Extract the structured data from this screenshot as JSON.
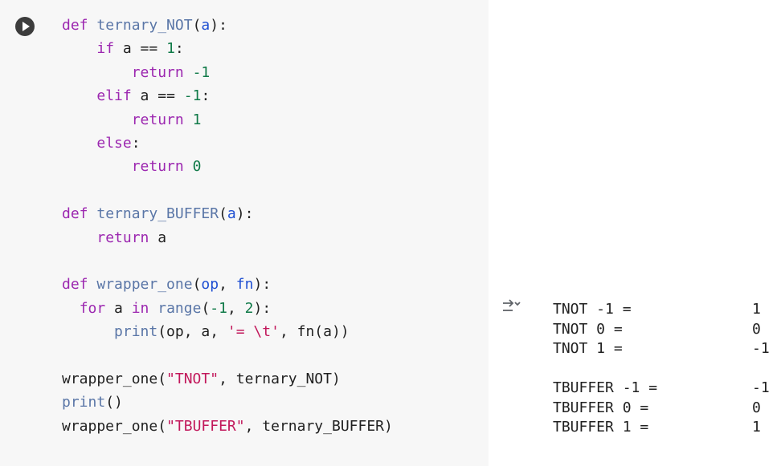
{
  "cell": {
    "code_tokens": [
      [
        [
          "kw",
          "def"
        ],
        [
          "plain",
          " "
        ],
        [
          "fn",
          "ternary_NOT"
        ],
        [
          "plain",
          "("
        ],
        [
          "param",
          "a"
        ],
        [
          "plain",
          "):"
        ]
      ],
      [
        [
          "plain",
          "    "
        ],
        [
          "kw",
          "if"
        ],
        [
          "plain",
          " a == "
        ],
        [
          "num",
          "1"
        ],
        [
          "plain",
          ":"
        ]
      ],
      [
        [
          "plain",
          "        "
        ],
        [
          "kw",
          "return"
        ],
        [
          "plain",
          " "
        ],
        [
          "num",
          "-1"
        ]
      ],
      [
        [
          "plain",
          "    "
        ],
        [
          "kw",
          "elif"
        ],
        [
          "plain",
          " a == "
        ],
        [
          "num",
          "-1"
        ],
        [
          "plain",
          ":"
        ]
      ],
      [
        [
          "plain",
          "        "
        ],
        [
          "kw",
          "return"
        ],
        [
          "plain",
          " "
        ],
        [
          "num",
          "1"
        ]
      ],
      [
        [
          "plain",
          "    "
        ],
        [
          "kw",
          "else"
        ],
        [
          "plain",
          ":"
        ]
      ],
      [
        [
          "plain",
          "        "
        ],
        [
          "kw",
          "return"
        ],
        [
          "plain",
          " "
        ],
        [
          "num",
          "0"
        ]
      ],
      [
        [
          "plain",
          ""
        ]
      ],
      [
        [
          "kw",
          "def"
        ],
        [
          "plain",
          " "
        ],
        [
          "fn",
          "ternary_BUFFER"
        ],
        [
          "plain",
          "("
        ],
        [
          "param",
          "a"
        ],
        [
          "plain",
          "):"
        ]
      ],
      [
        [
          "plain",
          "    "
        ],
        [
          "kw",
          "return"
        ],
        [
          "plain",
          " a"
        ]
      ],
      [
        [
          "plain",
          ""
        ]
      ],
      [
        [
          "kw",
          "def"
        ],
        [
          "plain",
          " "
        ],
        [
          "fn",
          "wrapper_one"
        ],
        [
          "plain",
          "("
        ],
        [
          "param",
          "op"
        ],
        [
          "plain",
          ", "
        ],
        [
          "param",
          "fn"
        ],
        [
          "plain",
          "):"
        ]
      ],
      [
        [
          "plain",
          "  "
        ],
        [
          "kw",
          "for"
        ],
        [
          "plain",
          " a "
        ],
        [
          "kw",
          "in"
        ],
        [
          "plain",
          " "
        ],
        [
          "fn",
          "range"
        ],
        [
          "plain",
          "("
        ],
        [
          "num",
          "-1"
        ],
        [
          "plain",
          ", "
        ],
        [
          "num",
          "2"
        ],
        [
          "plain",
          "):"
        ]
      ],
      [
        [
          "plain",
          "      "
        ],
        [
          "fn",
          "print"
        ],
        [
          "plain",
          "(op, a, "
        ],
        [
          "str",
          "'= \\t'"
        ],
        [
          "plain",
          ", fn(a))"
        ]
      ],
      [
        [
          "plain",
          ""
        ]
      ],
      [
        [
          "plain",
          "wrapper_one("
        ],
        [
          "str",
          "\"TNOT\""
        ],
        [
          "plain",
          ", ternary_NOT)"
        ]
      ],
      [
        [
          "fn",
          "print"
        ],
        [
          "plain",
          "()"
        ]
      ],
      [
        [
          "plain",
          "wrapper_one"
        ],
        [
          "plain",
          "("
        ],
        [
          "str",
          "\"TBUFFER\""
        ],
        [
          "plain",
          ", ternary_BUFFER"
        ],
        [
          "plain",
          ")"
        ]
      ]
    ]
  },
  "output": {
    "lines": [
      {
        "label": "TNOT -1 =",
        "value": "1"
      },
      {
        "label": "TNOT 0 =",
        "value": "0"
      },
      {
        "label": "TNOT 1 =",
        "value": "-1"
      },
      {
        "label": "",
        "value": ""
      },
      {
        "label": "TBUFFER -1 =",
        "value": "-1"
      },
      {
        "label": "TBUFFER 0 =",
        "value": "0"
      },
      {
        "label": "TBUFFER 1 =",
        "value": "1"
      }
    ]
  },
  "icons": {
    "run": "play-circle-icon",
    "output_toggle": "output-collapse-icon"
  }
}
